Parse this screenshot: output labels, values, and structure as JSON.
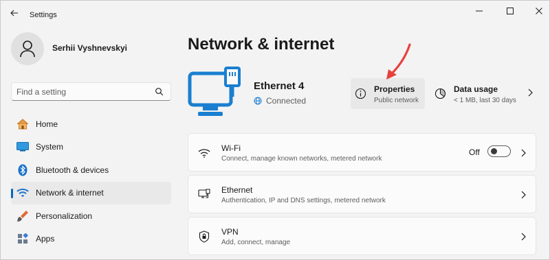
{
  "window": {
    "title": "Settings"
  },
  "profile": {
    "name": "Serhii Vyshnevskyi"
  },
  "search": {
    "placeholder": "Find a setting"
  },
  "sidebar": {
    "items": [
      {
        "label": "Home",
        "icon": "home-icon"
      },
      {
        "label": "System",
        "icon": "system-icon"
      },
      {
        "label": "Bluetooth & devices",
        "icon": "bluetooth-icon"
      },
      {
        "label": "Network & internet",
        "icon": "wifi-icon",
        "active": true
      },
      {
        "label": "Personalization",
        "icon": "personalization-icon"
      },
      {
        "label": "Apps",
        "icon": "apps-icon"
      }
    ]
  },
  "main": {
    "title": "Network & internet",
    "ethernet": {
      "name": "Ethernet 4",
      "status": "Connected"
    },
    "properties": {
      "title": "Properties",
      "subtitle": "Public network"
    },
    "data_usage": {
      "title": "Data usage",
      "subtitle": "< 1 MB, last 30 days"
    },
    "rows": [
      {
        "title": "Wi-Fi",
        "subtitle": "Connect, manage known networks, metered network",
        "toggle_label": "Off",
        "icon": "wifi-icon"
      },
      {
        "title": "Ethernet",
        "subtitle": "Authentication, IP and DNS settings, metered network",
        "icon": "ethernet-icon"
      },
      {
        "title": "VPN",
        "subtitle": "Add, connect, manage",
        "icon": "vpn-shield-icon"
      }
    ]
  },
  "colors": {
    "accent": "#0067c0",
    "annotation_arrow": "#e8413c",
    "hero_icon": "#1a7fd0"
  }
}
